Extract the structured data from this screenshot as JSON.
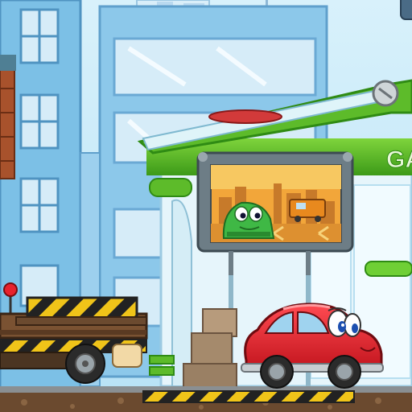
{
  "game": {
    "partial_sign_text": "GA",
    "player": "red-car-with-eyes",
    "obstacle": "striped-barrier-on-flatbed-truck",
    "billboard": {
      "content": "green-car-with-eyes-in-front-of-city-and-orange-truck"
    }
  },
  "palette": {
    "sky": "#bfe6f7",
    "building_blue": "#7cc0e6",
    "building_light": "#bfe0f3",
    "station_green": "#5dbb2a",
    "station_dark_green": "#2f8b14",
    "ground_brown": "#6b4a2f",
    "hazard_yellow": "#f0c419",
    "car_red": "#e8222d"
  }
}
